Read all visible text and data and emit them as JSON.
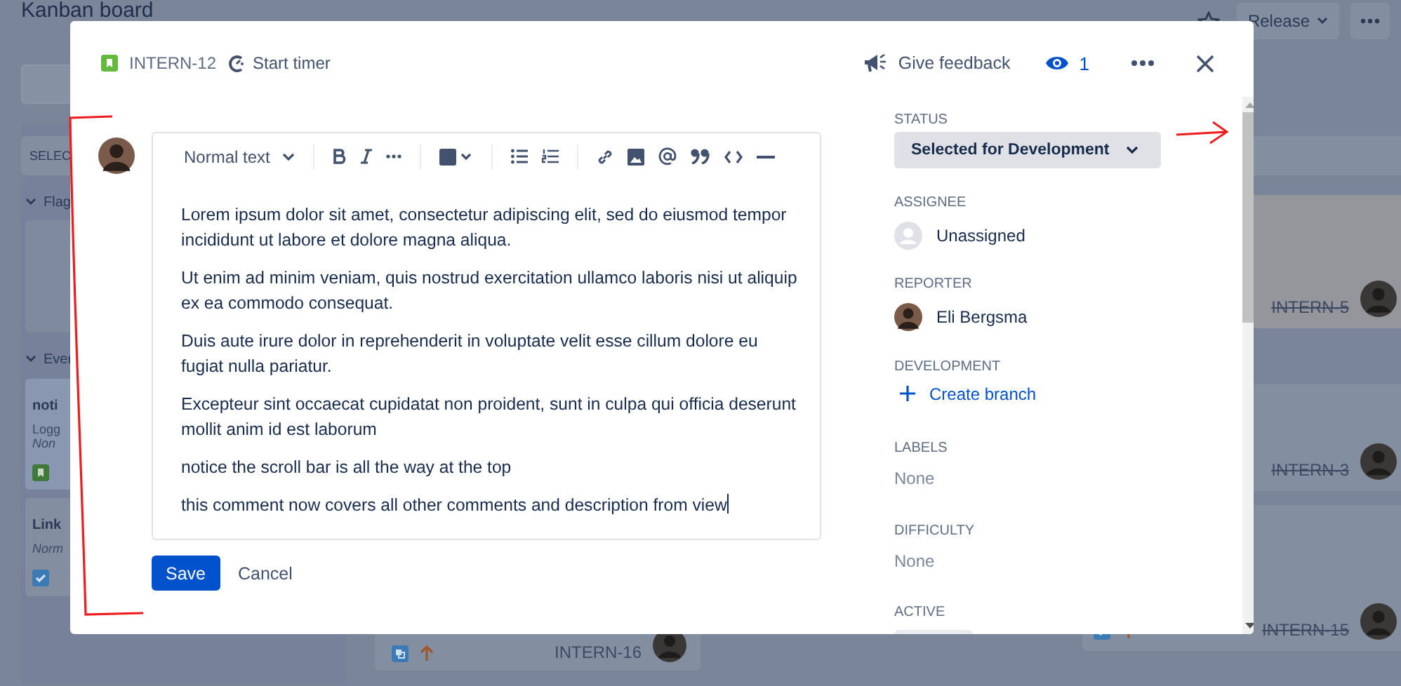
{
  "board": {
    "title": "Kanban board",
    "release_button": "Release"
  },
  "left_column": {
    "header": "SELEC",
    "sections": [
      {
        "label": "Flag",
        "expanded": true
      },
      {
        "label": "Ever",
        "expanded": true,
        "cards": [
          {
            "title": "noti",
            "lines": [
              {
                "text": "Logg",
                "italic": false
              },
              {
                "text": "Non",
                "italic": true
              }
            ],
            "kind": "story",
            "selected": true
          },
          {
            "title": "Link",
            "lines": [
              {
                "text": "Norm",
                "italic": true
              }
            ],
            "kind": "task",
            "selected": false
          }
        ]
      }
    ]
  },
  "middle_column": {
    "cards": [
      {
        "key": "INTERN-16",
        "kind": "subtask",
        "done": false
      }
    ]
  },
  "right_column": {
    "cards": [
      {
        "key": "INTERN-5",
        "kind": "plain",
        "done": true,
        "selected": true
      },
      {
        "key": "INTERN-3",
        "kind": "plain",
        "done": true,
        "selected": false
      },
      {
        "key": "INTERN-15",
        "kind": "task",
        "done": true,
        "selected": false
      }
    ]
  },
  "modal": {
    "issue_key": "INTERN-12",
    "timer": "Start timer",
    "feedback": "Give feedback",
    "watchers": "1",
    "comment": {
      "text_style": "Normal text",
      "paragraphs": [
        "Lorem ipsum dolor sit amet, consectetur adipiscing elit, sed do eiusmod tempor incididunt ut labore et dolore magna aliqua.",
        "Ut enim ad minim veniam, quis nostrud exercitation ullamco laboris nisi ut aliquip ex ea commodo consequat.",
        "Duis aute irure dolor in reprehenderit in voluptate velit esse cillum dolore eu fugiat nulla pariatur.",
        "Excepteur sint occaecat cupidatat non proident, sunt in culpa qui officia deserunt mollit anim id est laborum",
        "notice the scroll bar is all the way at the top",
        "this comment now covers all other comments and description from view"
      ],
      "save": "Save",
      "cancel": "Cancel"
    },
    "fields": [
      {
        "label": "STATUS",
        "kind": "status",
        "value": "Selected for Development"
      },
      {
        "label": "ASSIGNEE",
        "kind": "unassigned",
        "value": "Unassigned"
      },
      {
        "label": "REPORTER",
        "kind": "user",
        "value": "Eli Bergsma"
      },
      {
        "label": "DEVELOPMENT",
        "kind": "action",
        "value": "Create branch"
      },
      {
        "label": "LABELS",
        "kind": "empty",
        "value": "None"
      },
      {
        "label": "DIFFICULTY",
        "kind": "empty",
        "value": "None"
      },
      {
        "label": "ACTIVE",
        "kind": "chip"
      }
    ]
  }
}
